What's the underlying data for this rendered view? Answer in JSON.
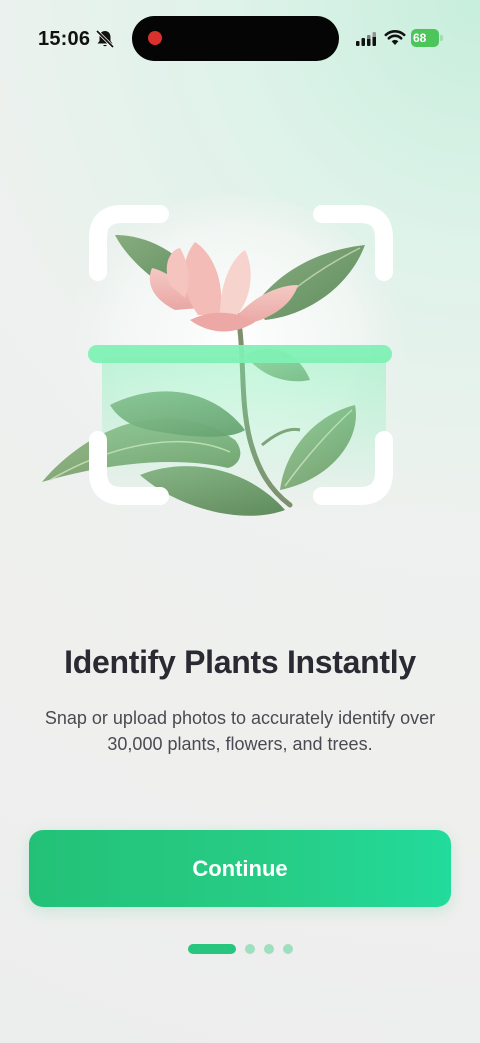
{
  "status_bar": {
    "time": "15:06",
    "battery": "68",
    "icons": [
      "bell-off-icon",
      "signal-icon",
      "wifi-icon",
      "battery-icon"
    ]
  },
  "onboarding": {
    "title": "Identify Plants Instantly",
    "subtitle": "Snap or upload photos to accurately identify over 30,000 plants, flowers, and trees.",
    "continue_label": "Continue"
  },
  "pagination": {
    "total": 4,
    "current": 1
  },
  "colors": {
    "accent": "#27c882",
    "scan_line": "#7ff0b4",
    "title": "#2b2a33",
    "body_text": "#4a4b52",
    "battery": "#4cc55a"
  }
}
